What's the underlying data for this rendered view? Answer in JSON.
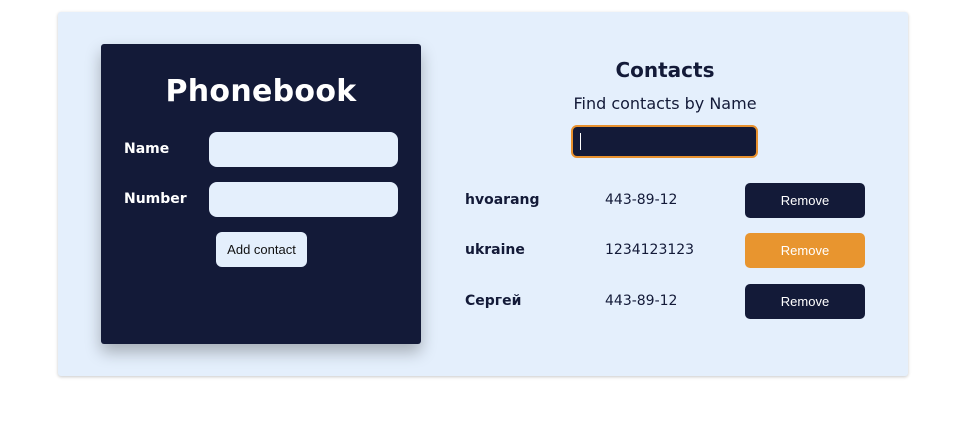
{
  "phonebook": {
    "title": "Phonebook",
    "name_label": "Name",
    "name_value": "",
    "number_label": "Number",
    "number_value": "",
    "add_button": "Add contact"
  },
  "contacts": {
    "title": "Contacts",
    "filter_label": "Find contacts by Name",
    "filter_value": "",
    "remove_label": "Remove",
    "items": [
      {
        "name": "hvoarang",
        "number": "443-89-12"
      },
      {
        "name": "ukraine",
        "number": "1234123123"
      },
      {
        "name": "Сергей",
        "number": "443-89-12"
      }
    ]
  },
  "colors": {
    "background": "#e4effc",
    "dark": "#131a38",
    "accent": "#e8952f"
  }
}
